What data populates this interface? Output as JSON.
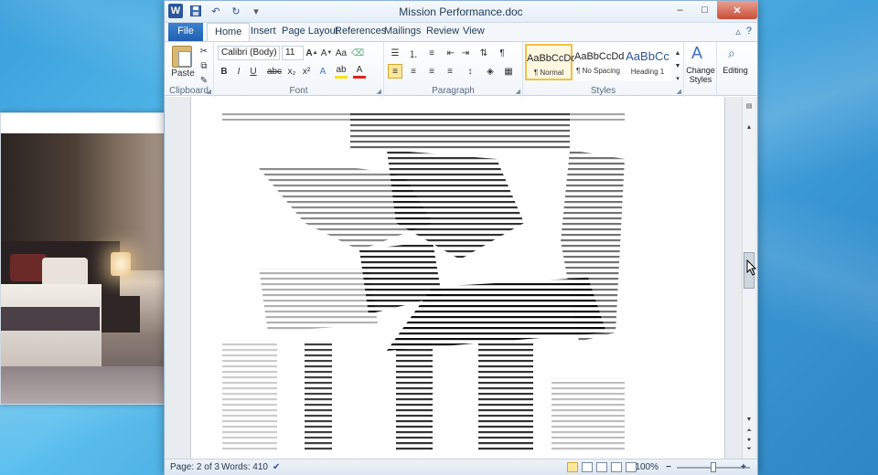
{
  "window": {
    "title": "Mission Performance.doc"
  },
  "quick_access": {
    "word_icon": "word-logo",
    "save_icon": "save-icon",
    "undo_icon": "undo-icon",
    "redo_icon": "redo-icon",
    "customize_icon": "chevron-down-icon"
  },
  "title_controls": {
    "minimize": "–",
    "maximize": "□",
    "close": "✕"
  },
  "tabs": [
    "File",
    "Home",
    "Insert",
    "Page Layout",
    "References",
    "Mailings",
    "Review",
    "View"
  ],
  "ribbon": {
    "clipboard": {
      "label": "Clipboard",
      "paste": "Paste"
    },
    "font": {
      "label": "Font",
      "name": "Calibri (Body)",
      "size": "11"
    },
    "paragraph": {
      "label": "Paragraph"
    },
    "styles": {
      "label": "Styles",
      "items": [
        {
          "sample": "AaBbCcDd",
          "name": "¶ Normal"
        },
        {
          "sample": "AaBbCcDd",
          "name": "¶ No Spacing"
        },
        {
          "sample": "AaBbCc",
          "name": "Heading 1"
        }
      ],
      "change": "Change Styles"
    },
    "editing": {
      "label": "Editing"
    }
  },
  "status": {
    "page": "Page: 2 of 3",
    "words": "Words: 410",
    "zoom": "100%",
    "zoom_fraction": 1.0
  },
  "colors": {
    "accent": "#2b579a",
    "file_tab": "#1f5fb0",
    "close": "#c94d38",
    "highlight": "#ffe79a"
  }
}
